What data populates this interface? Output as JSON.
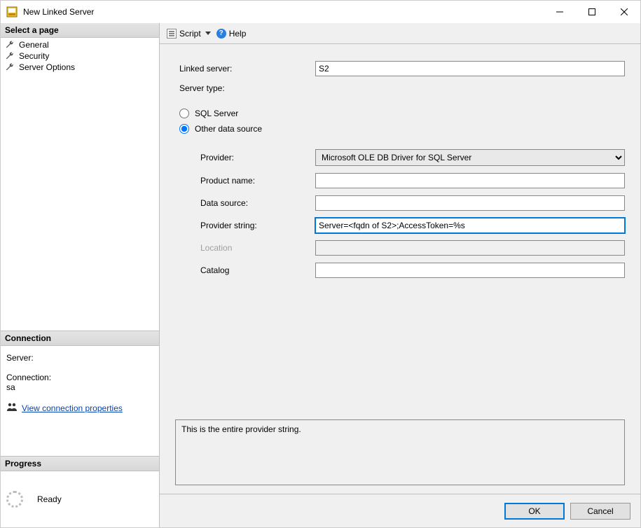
{
  "window": {
    "title": "New Linked Server"
  },
  "sidebar": {
    "select_page": "Select a page",
    "pages": [
      "General",
      "Security",
      "Server Options"
    ],
    "connection_header": "Connection",
    "server_label": "Server:",
    "server_value": "",
    "connection_label": "Connection:",
    "connection_value": "sa",
    "view_props": "View connection properties",
    "progress_header": "Progress",
    "progress_status": "Ready"
  },
  "toolbar": {
    "script": "Script",
    "help": "Help"
  },
  "form": {
    "linked_server_label": "Linked server:",
    "linked_server_value": "S2",
    "server_type_label": "Server type:",
    "radio_sql": "SQL Server",
    "radio_other": "Other data source",
    "provider_label": "Provider:",
    "provider_value": "Microsoft OLE DB Driver for SQL Server",
    "product_name_label": "Product name:",
    "product_name_value": "",
    "data_source_label": "Data source:",
    "data_source_value": "",
    "provider_string_label": "Provider string:",
    "provider_string_value": "Server=<fqdn of S2>;AccessToken=%s",
    "location_label": "Location",
    "location_value": "",
    "catalog_label": "Catalog",
    "catalog_value": "",
    "message": "This is the entire provider string."
  },
  "buttons": {
    "ok": "OK",
    "cancel": "Cancel"
  }
}
